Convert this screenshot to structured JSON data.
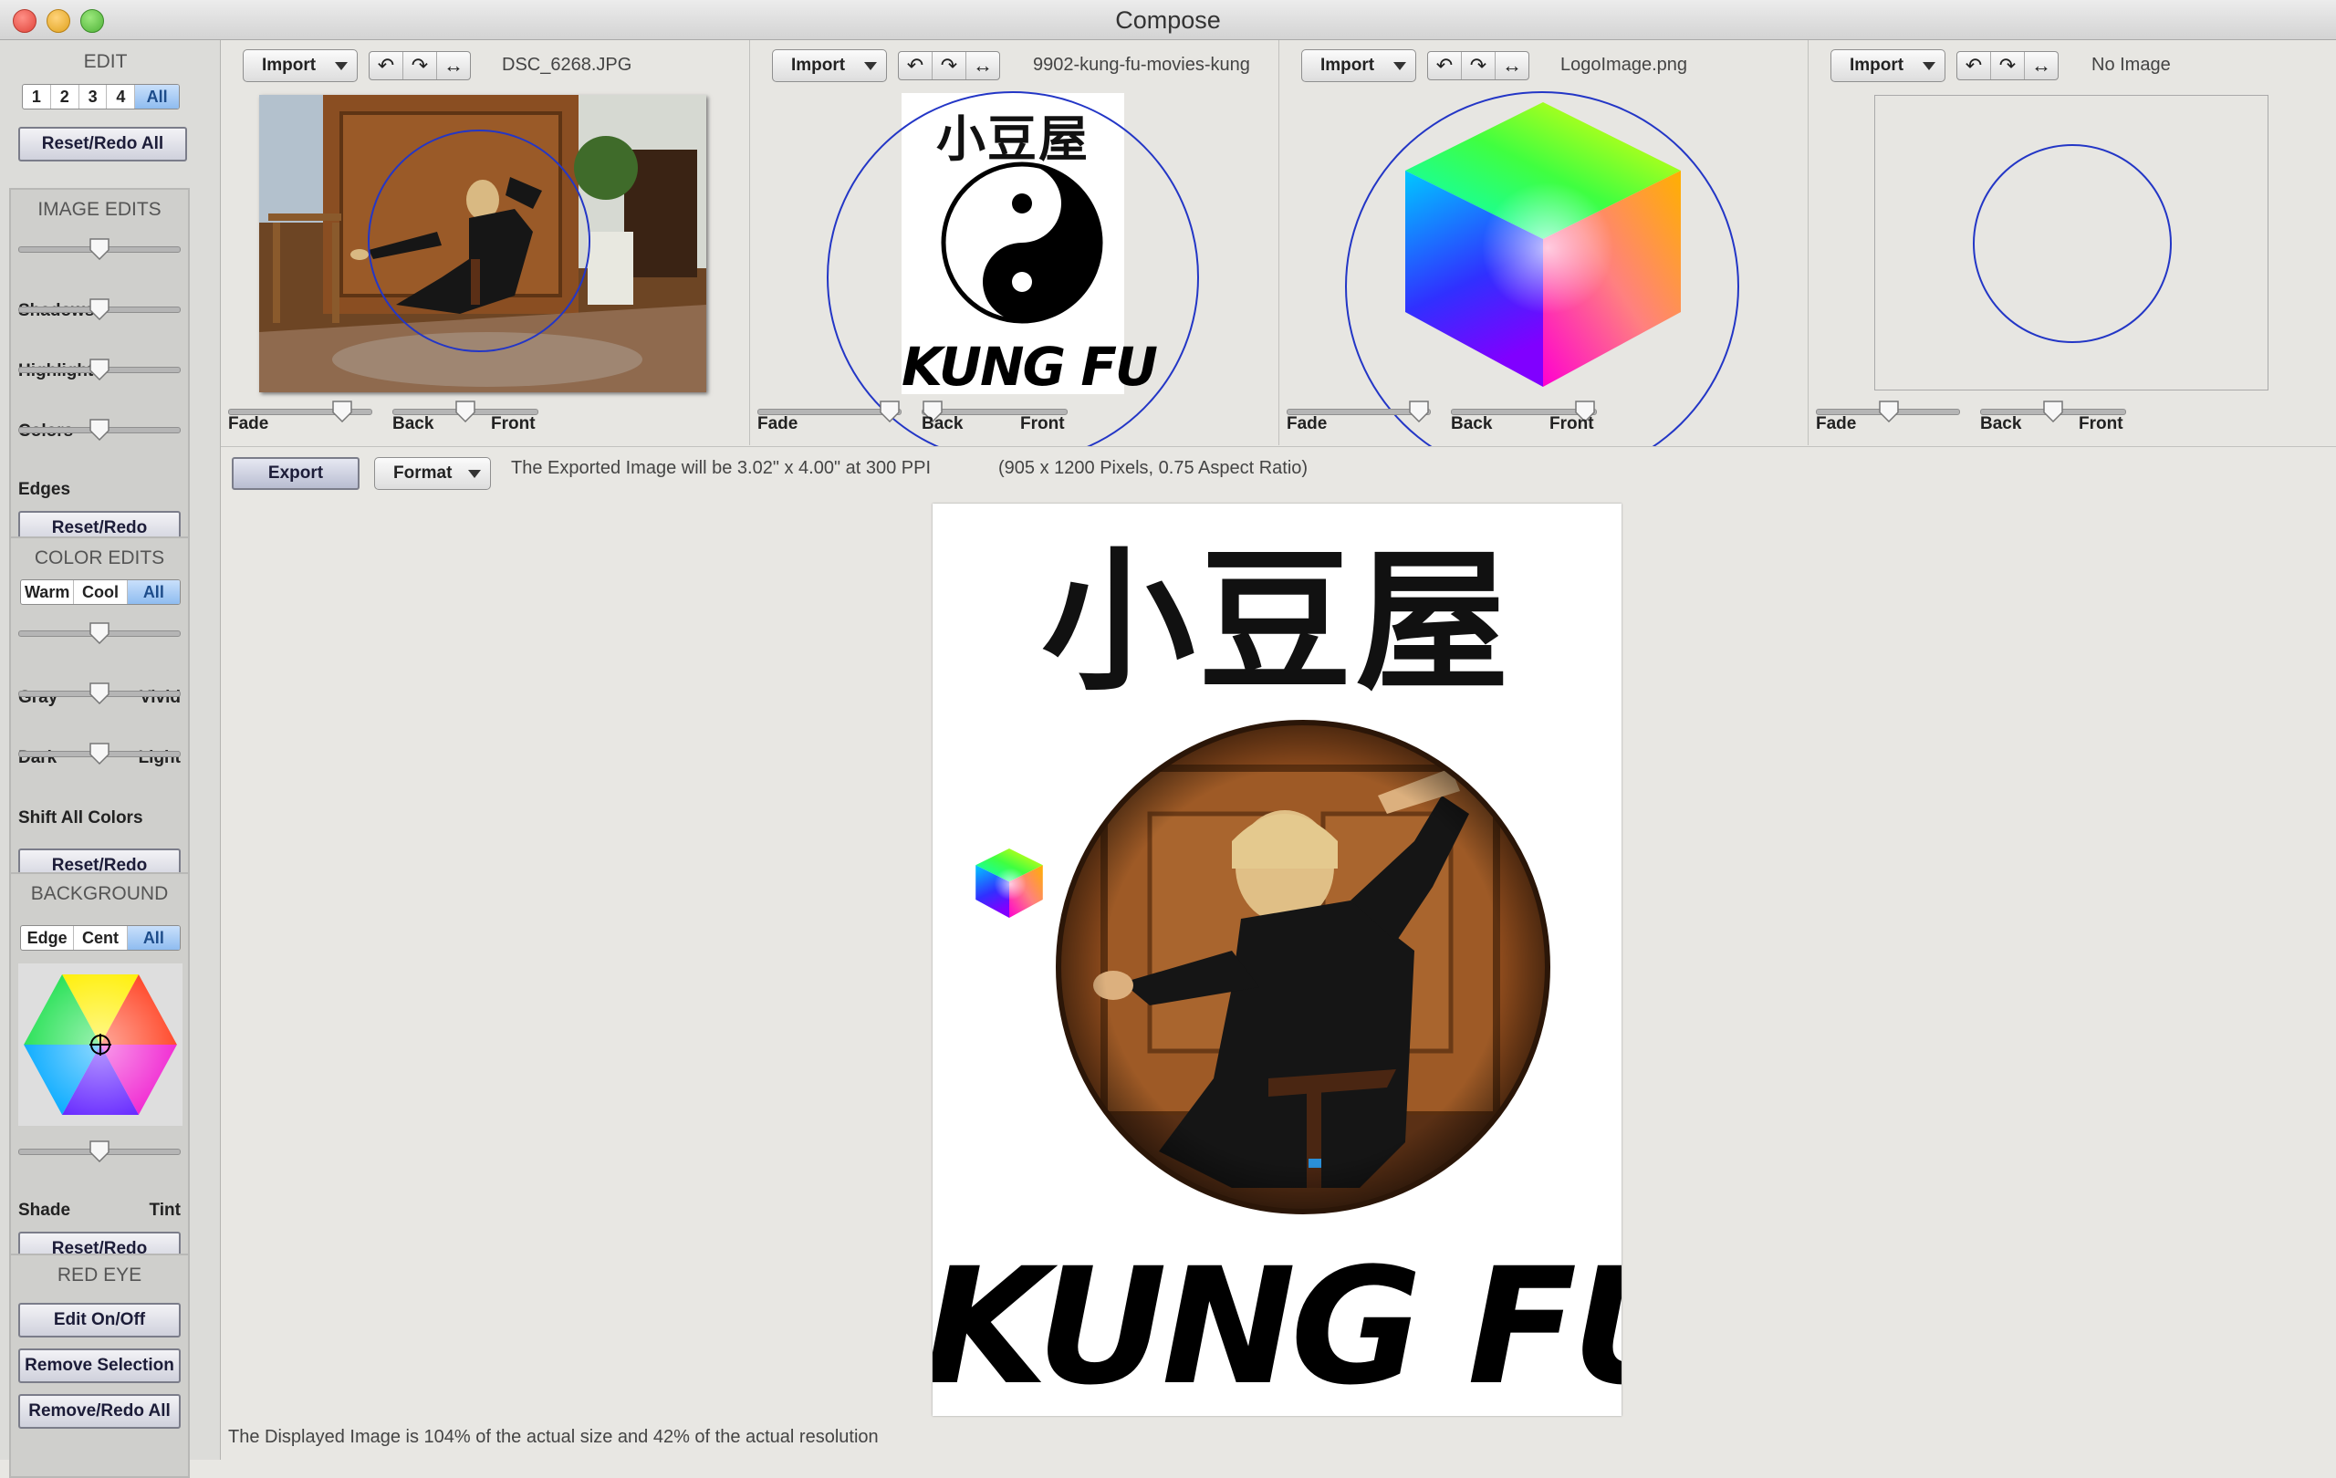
{
  "window": {
    "title": "Compose"
  },
  "sidebar": {
    "edit": {
      "title": "EDIT",
      "tabs": [
        "1",
        "2",
        "3",
        "4",
        "All"
      ],
      "selected": "All",
      "reset_all": "Reset/Redo All"
    },
    "image_edits": {
      "title": "IMAGE EDITS",
      "sliders": [
        {
          "label": "Shadows",
          "value": 0.5
        },
        {
          "label": "Highlights",
          "value": 0.5
        },
        {
          "label": "Colors",
          "value": 0.5
        },
        {
          "label": "Edges",
          "value": 0.5
        }
      ],
      "reset": "Reset/Redo"
    },
    "color_edits": {
      "title": "COLOR EDITS",
      "tabs": [
        "Warm",
        "Cool",
        "All"
      ],
      "selected": "All",
      "sliders": [
        {
          "left": "Gray",
          "right": "Vivid",
          "value": 0.5
        },
        {
          "left": "Dark",
          "right": "Light",
          "value": 0.5
        },
        {
          "left": "Shift All Colors",
          "right": "",
          "value": 0.5
        }
      ],
      "reset": "Reset/Redo"
    },
    "background": {
      "title": "BACKGROUND",
      "tabs": [
        "Edge",
        "Cent",
        "All"
      ],
      "selected": "All",
      "shade_left": "Shade",
      "shade_right": "Tint",
      "shade_value": 0.5,
      "reset": "Reset/Redo"
    },
    "red_eye": {
      "title": "RED EYE",
      "buttons": [
        "Edit On/Off",
        "Remove Selection",
        "Remove/Redo All"
      ]
    }
  },
  "panels": [
    {
      "import": "Import",
      "file": "DSC_6268.JPG",
      "fade": "Fade",
      "back": "Back",
      "front": "Front",
      "fade_value": 0.78,
      "order_value": 0.5
    },
    {
      "import": "Import",
      "file": "9902-kung-fu-movies-kung",
      "fade": "Fade",
      "back": "Back",
      "front": "Front",
      "fade_value": 0.9,
      "order_value": 0.1
    },
    {
      "import": "Import",
      "file": "LogoImage.png",
      "fade": "Fade",
      "back": "Back",
      "front": "Front",
      "fade_value": 0.9,
      "order_value": 0.9
    },
    {
      "import": "Import",
      "file": "No Image",
      "fade": "Fade",
      "back": "Back",
      "front": "Front",
      "fade_value": 0.5,
      "order_value": 0.5
    }
  ],
  "toolbar": {
    "export": "Export",
    "format": "Format",
    "export_info": "The Exported Image will be  3.02\" x 4.00\" at 300 PPI",
    "pixel_info": "(905 x 1200 Pixels,  0.75 Aspect Ratio)"
  },
  "canvas": {
    "kanji": "小豆屋",
    "thumb_kanji": "小豆屋",
    "thumb_text": "KUNG FU",
    "banner_text": "KUNG  FU"
  },
  "status": "The Displayed Image is 104% of the actual size and 42% of the actual resolution",
  "colors": {
    "ring": "#2336c6",
    "selected_tab": "#8fbcf0",
    "button_border": "#7b7d8a"
  }
}
